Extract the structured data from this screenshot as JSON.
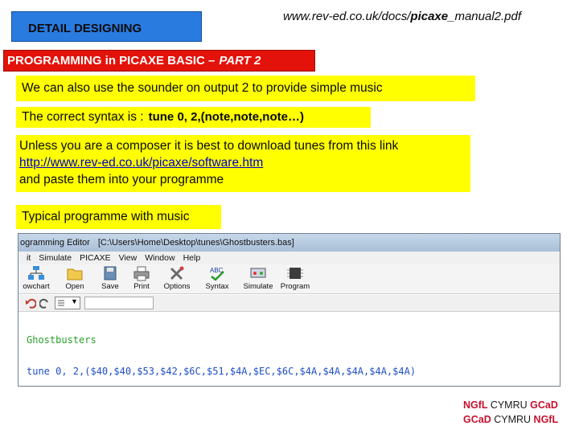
{
  "header": {
    "detail_label": "DETAIL DESIGNING",
    "url_prefix": "www.rev-ed.co.uk/docs/",
    "url_emph": "picaxe",
    "url_suffix": "_manual2.pdf",
    "section_title": "PROGRAMMING in PICAXE BASIC –",
    "section_part": "PART 2"
  },
  "boxes": {
    "intro": "We can also use the sounder on output 2 to provide simple music",
    "syntax_label": "The correct syntax is :",
    "syntax_code": "tune 0, 2,(note,note,note…)",
    "download_line1": " Unless you are a composer it is best to download tunes from this link",
    "download_link": "http://www.rev-ed.co.uk/picaxe/software.htm",
    "download_line3": "and paste them into your programme",
    "typical": "Typical programme with music"
  },
  "editor": {
    "title": "ogramming Editor",
    "path": "[C:\\Users\\Home\\Desktop\\tunes\\Ghostbusters.bas]",
    "menu": [
      "it",
      "Simulate",
      "PICAXE",
      "View",
      "Window",
      "Help"
    ],
    "toolbar": [
      "owchart",
      "Open",
      "Save",
      "Print",
      "Options",
      "Syntax",
      "Simulate",
      "Program"
    ],
    "code_line1": "Ghostbusters",
    "code_line2": "tune 0, 2,($40,$40,$53,$42,$6C,$51,$4A,$EC,$6C,$4A,$4A,$4A,$4A,$4A)"
  },
  "logos": {
    "top_a": "NGfL",
    "top_b": "CYMRU",
    "top_c": "GCaD",
    "bottom_a": "GCaD",
    "bottom_b": "CYMRU",
    "bottom_c": "NGfL"
  },
  "colors": {
    "header_blue": "#2a7be0",
    "title_red": "#e3120b",
    "highlight_yellow": "#ffff00"
  }
}
